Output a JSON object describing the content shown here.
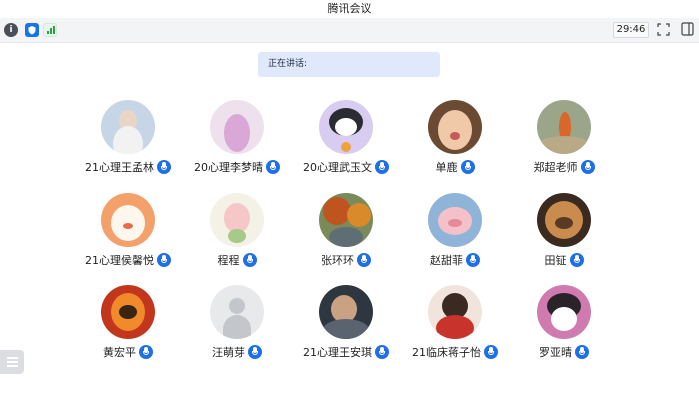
{
  "app": {
    "title": "腾讯会议"
  },
  "toolbar": {
    "timer": "29:46",
    "icons": [
      "info-icon",
      "shield-icon",
      "signal-icon",
      "fullscreen-icon",
      "layout-icon"
    ]
  },
  "speaking": {
    "label": "正在讲话:"
  },
  "participants": [
    {
      "name": "21心理王孟林",
      "mic_icon": "mic-icon"
    },
    {
      "name": "20心理李梦晴",
      "mic_icon": "mic-icon"
    },
    {
      "name": "20心理武玉文",
      "mic_icon": "mic-icon"
    },
    {
      "name": "单鹿",
      "mic_icon": "mic-icon"
    },
    {
      "name": "郑超老师",
      "mic_icon": "mic-icon"
    },
    {
      "name": "21心理侯馨悦",
      "mic_icon": "mic-icon"
    },
    {
      "name": "程程",
      "mic_icon": "mic-icon"
    },
    {
      "name": "张环环",
      "mic_icon": "mic-icon"
    },
    {
      "name": "赵甜菲",
      "mic_icon": "mic-icon"
    },
    {
      "name": "田钲",
      "mic_icon": "mic-icon"
    },
    {
      "name": "黄宏平",
      "mic_icon": "mic-icon"
    },
    {
      "name": "汪萌芽",
      "mic_icon": "mic-icon"
    },
    {
      "name": "21心理王安琪",
      "mic_icon": "mic-icon"
    },
    {
      "name": "21临床蒋子怡",
      "mic_icon": "mic-icon"
    },
    {
      "name": "罗亚晴",
      "mic_icon": "mic-icon"
    }
  ],
  "colors": {
    "accent": "#1e6fe8",
    "speaking_bg": "#dfe9fb",
    "toolbar_bg": "#f3f4f6"
  }
}
